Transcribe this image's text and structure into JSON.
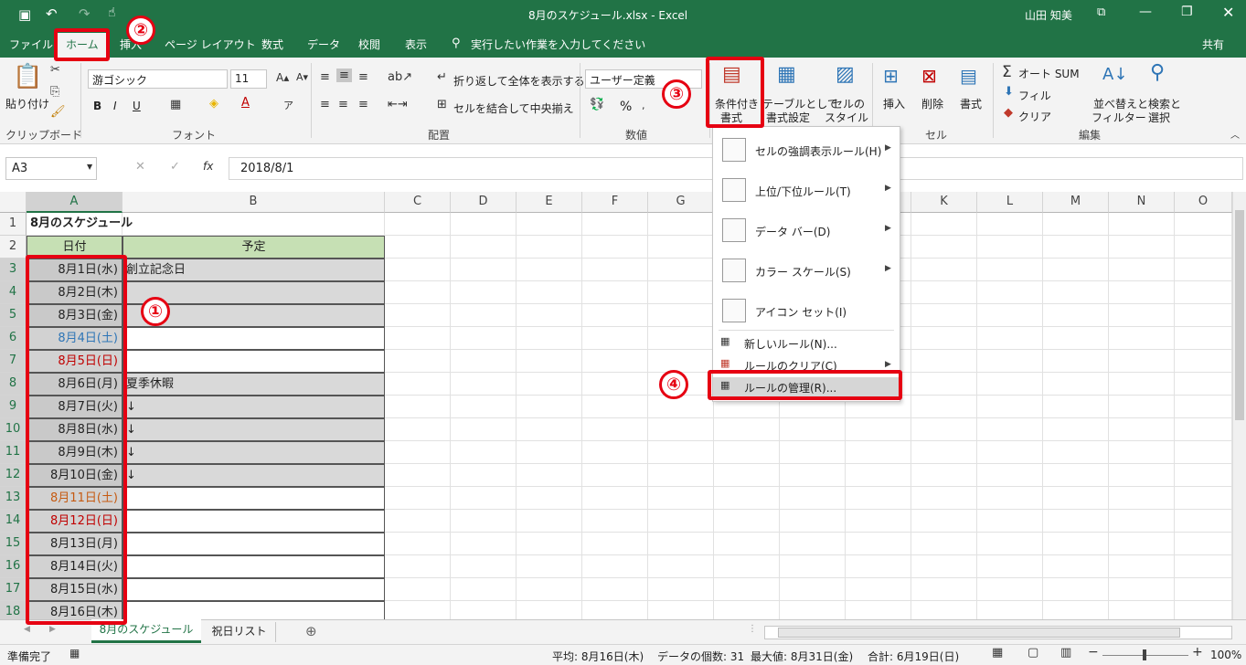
{
  "titlebar": {
    "filename": "8月のスケジュール.xlsx  -  Excel",
    "user": "山田 知美"
  },
  "tabs": [
    "ファイル",
    "ホーム",
    "挿入",
    "ページ レイアウト",
    "数式",
    "データ",
    "校閲",
    "表示"
  ],
  "search_placeholder": "実行したい作業を入力してください",
  "share": "共有",
  "ribbon": {
    "paste": "貼り付け",
    "clipboard": "クリップボード",
    "font_name": "游ゴシック",
    "font_size": "11",
    "font_group": "フォント",
    "wrap": "折り返して全体を表示する",
    "merge": "セルを結合して中央揃え",
    "align_group": "配置",
    "number_format": "ユーザー定義",
    "number_group": "数値",
    "cond_fmt_1": "条件付き",
    "cond_fmt_2": "書式",
    "table_fmt_1": "テーブルとして",
    "table_fmt_2": "書式設定",
    "cell_style_1": "セルの",
    "cell_style_2": "スタイル",
    "insert": "挿入",
    "delete": "削除",
    "format": "書式",
    "cells_group": "セル",
    "autosum": "オート SUM",
    "fill": "フィル",
    "clear": "クリア",
    "sort_1": "並べ替えと",
    "sort_2": "フィルター",
    "find_1": "検索と",
    "find_2": "選択",
    "edit_group": "編集",
    "bold": "B",
    "italic": "I",
    "underline": "U",
    "percent": "%"
  },
  "formula": {
    "namebox": "A3",
    "fx": "fx",
    "value": "2018/8/1"
  },
  "columns": [
    "A",
    "B",
    "C",
    "D",
    "E",
    "F",
    "G",
    "H",
    "I",
    "J",
    "K",
    "L",
    "M",
    "N",
    "O"
  ],
  "rows": [
    "1",
    "2",
    "3",
    "4",
    "5",
    "6",
    "7",
    "8",
    "9",
    "10",
    "11",
    "12",
    "13",
    "14",
    "15",
    "16",
    "17",
    "18"
  ],
  "sheet": {
    "title": "8月のスケジュール",
    "h_date": "日付",
    "h_plan": "予定",
    "dates": [
      "8月1日(水)",
      "8月2日(木)",
      "8月3日(金)",
      "8月4日(土)",
      "8月5日(日)",
      "8月6日(月)",
      "8月7日(火)",
      "8月8日(水)",
      "8月9日(木)",
      "8月10日(金)",
      "8月11日(土)",
      "8月12日(日)",
      "8月13日(月)",
      "8月14日(火)",
      "8月15日(水)",
      "8月16日(木)"
    ],
    "plans": [
      "創立記念日",
      "",
      "",
      "",
      "",
      "夏季休暇",
      "↓",
      "↓",
      "↓",
      "↓",
      "",
      "",
      "",
      "",
      "",
      ""
    ]
  },
  "menu": {
    "items": [
      "セルの強調表示ルール(H)",
      "上位/下位ルール(T)",
      "データ バー(D)",
      "カラー スケール(S)",
      "アイコン セット(I)",
      "新しいルール(N)...",
      "ルールのクリア(C)",
      "ルールの管理(R)..."
    ]
  },
  "sheettabs": [
    "8月のスケジュール",
    "祝日リスト"
  ],
  "status": {
    "ready": "準備完了",
    "avg": "平均: 8月16日(木)",
    "count": "データの個数: 31",
    "max": "最大値: 8月31日(金)",
    "sum": "合計: 6月19日(日)",
    "zoom": "100%"
  },
  "annotations": [
    "②",
    "③",
    "①",
    "④"
  ],
  "colors": {
    "excel_green": "#217346",
    "red": "#e60012",
    "sat_blue": "#2e75b6",
    "sun_red": "#c00000",
    "hol_orange": "#c55a11"
  }
}
